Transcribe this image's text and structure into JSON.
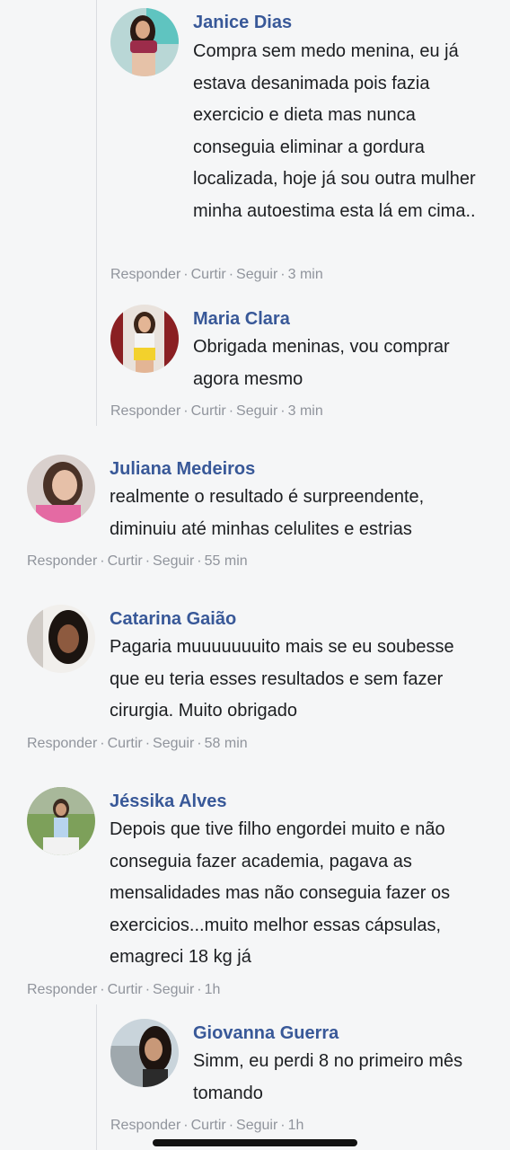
{
  "comments": [
    {
      "name": "Janice Dias",
      "text": "Compra sem medo menina, eu já estava desanimada pois fazia exercicio e dieta mas nunca conseguia eliminar a gordura localizada, hoje já sou outra mulher minha autoestima esta lá em cima..",
      "reply": "Responder",
      "like": "Curtir",
      "follow": "Seguir",
      "time": "3 min"
    },
    {
      "name": "Maria Clara",
      "text": "Obrigada meninas, vou comprar agora mesmo",
      "reply": "Responder",
      "like": "Curtir",
      "follow": "Seguir",
      "time": "3 min"
    },
    {
      "name": "Juliana Medeiros",
      "text": "realmente o resultado é surpreendente, diminuiu até minhas celulites e estrias",
      "reply": "Responder",
      "like": "Curtir",
      "follow": "Seguir",
      "time": "55 min"
    },
    {
      "name": "Catarina Gaião",
      "text": "Pagaria muuuuuuuito mais se eu soubesse que eu teria esses resultados e sem fazer cirurgia. Muito obrigado",
      "reply": "Responder",
      "like": "Curtir",
      "follow": "Seguir",
      "time": "58 min"
    },
    {
      "name": "Jéssika Alves",
      "text": "Depois que tive filho engordei muito e não conseguia fazer academia, pagava as mensalidades mas não conseguia fazer os exercicios...muito melhor essas cápsulas, emagreci 18 kg já",
      "reply": "Responder",
      "like": "Curtir",
      "follow": "Seguir",
      "time": "1h"
    },
    {
      "name": "Giovanna Guerra",
      "text": "Simm, eu perdi 8 no primeiro mês tomando",
      "reply": "Responder",
      "like": "Curtir",
      "follow": "Seguir",
      "time": "1h"
    }
  ],
  "meta_separator": "·",
  "colors": {
    "name": "#385898",
    "text": "#1c1e21",
    "meta": "#90949c",
    "background": "#f5f6f7"
  },
  "avatars": [
    "user-photo-avatar",
    "user-photo-avatar",
    "user-photo-avatar",
    "user-photo-avatar",
    "user-photo-avatar",
    "user-photo-avatar"
  ]
}
